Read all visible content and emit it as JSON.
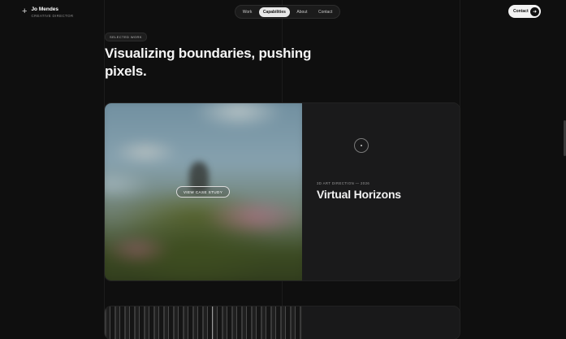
{
  "brand": {
    "icon": "plus-icon",
    "name": "Jo Mendes",
    "role": "CREATIVE DIRECTOR"
  },
  "nav": {
    "items": [
      {
        "label": "Work",
        "active": false
      },
      {
        "label": "Capabilities",
        "active": true
      },
      {
        "label": "About",
        "active": false
      },
      {
        "label": "Contact",
        "active": false
      }
    ]
  },
  "header_cta": {
    "label": "Contact",
    "icon": "arrow-right-icon"
  },
  "section": {
    "tag": "SELECTED WORK",
    "headline": "Visualizing boundaries, pushing pixels."
  },
  "project": {
    "cta": "VIEW CASE STUDY",
    "meta": "3D ART DIRECTION — 2026",
    "title": "Virtual Horizons"
  },
  "colors": {
    "background": "#0f0f0f",
    "card": "#1a1a1b",
    "accent": "#f2f2f2"
  }
}
